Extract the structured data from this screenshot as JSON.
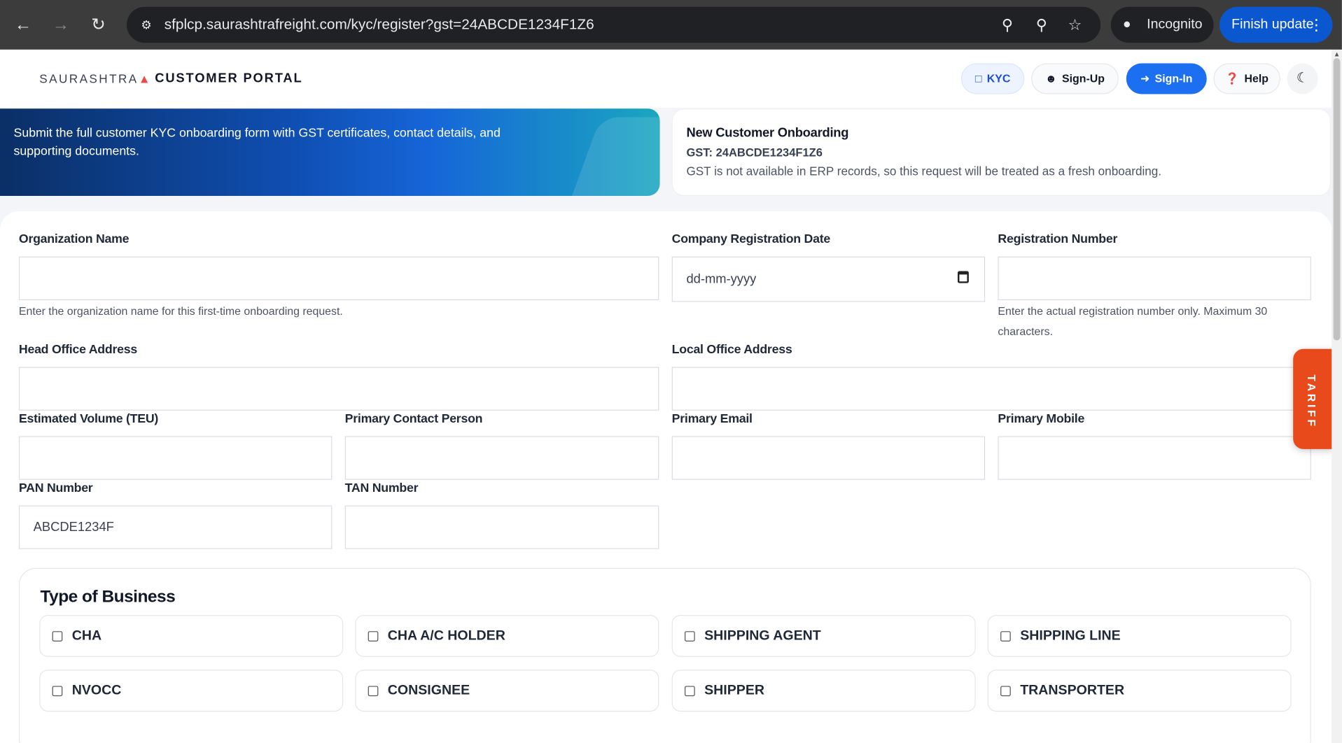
{
  "browser": {
    "url": "sfplcp.saurashtrafreight.com/kyc/register?gst=24ABCDE1234F1Z6",
    "incognito_label": "Incognito",
    "finish_update_label": "Finish update"
  },
  "header": {
    "logo": "SAURASHTRA",
    "portal_title": "CUSTOMER PORTAL",
    "buttons": {
      "kyc": "KYC",
      "signup": "Sign-Up",
      "signin": "Sign-In",
      "help": "Help"
    }
  },
  "hero": {
    "text": "Submit the full customer KYC onboarding form with GST certificates, contact details, and supporting documents."
  },
  "info": {
    "title": "New Customer Onboarding",
    "gst": "GST: 24ABCDE1234F1Z6",
    "description": "GST is not available in ERP records, so this request will be treated as a fresh onboarding."
  },
  "form": {
    "org_name": {
      "label": "Organization Name",
      "value": "",
      "help": "Enter the organization name for this first-time onboarding request."
    },
    "reg_date": {
      "label": "Company Registration Date",
      "placeholder": "dd-mm-yyyy"
    },
    "reg_number": {
      "label": "Registration Number",
      "value": "",
      "help": "Enter the actual registration number only. Maximum 30 characters."
    },
    "head_office": {
      "label": "Head Office Address",
      "value": ""
    },
    "local_office": {
      "label": "Local Office Address",
      "value": ""
    },
    "volume": {
      "label": "Estimated Volume (TEU)",
      "value": ""
    },
    "contact_person": {
      "label": "Primary Contact Person",
      "value": ""
    },
    "email": {
      "label": "Primary Email",
      "value": ""
    },
    "mobile": {
      "label": "Primary Mobile",
      "value": ""
    },
    "pan": {
      "label": "PAN Number",
      "value": "ABCDE1234F"
    },
    "tan": {
      "label": "TAN Number",
      "value": ""
    }
  },
  "tariff_label": "TARIFF",
  "business": {
    "title": "Type of Business",
    "options": [
      "CHA",
      "CHA A/C HOLDER",
      "SHIPPING AGENT",
      "SHIPPING LINE",
      "NVOCC",
      "CONSIGNEE",
      "SHIPPER",
      "TRANSPORTER"
    ]
  },
  "colors": {
    "primary": "#1d6ff2",
    "tariff": "#e84a1c",
    "chrome": "#3c3c3c"
  }
}
